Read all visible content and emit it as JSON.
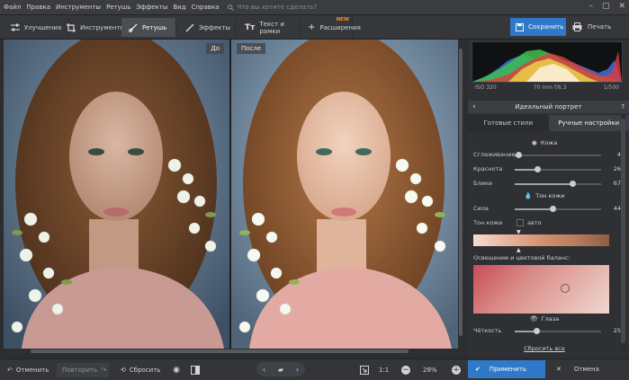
{
  "menu": {
    "items": [
      "Файл",
      "Правка",
      "Инструменты",
      "Ретушь",
      "Эффекты",
      "Вид",
      "Справка"
    ],
    "search_placeholder": "Что вы хотите сделать?"
  },
  "toolbar": {
    "tabs": [
      "Улучшения",
      "Инструменты",
      "Ретушь",
      "Эффекты",
      "Текст и рамки",
      "Расширения"
    ],
    "new_badge": "NEW",
    "save_label": "Сохранить",
    "print_label": "Печать"
  },
  "canvas": {
    "before_label": "До",
    "after_label": "После"
  },
  "histogram": {
    "exif": [
      "ISO 320",
      "70 mm f/6.3",
      "1/500"
    ]
  },
  "panel": {
    "title": "Идеальный портрет",
    "help": "?",
    "subtabs": [
      "Готовые стили",
      "Ручные настройки"
    ],
    "skin_section": "Кожа",
    "sliders_skin": [
      {
        "label": "Сглаживание",
        "value": "4",
        "fraction": 0.04
      },
      {
        "label": "Краснота",
        "value": "26",
        "fraction": 0.26
      },
      {
        "label": "Блики",
        "value": "67",
        "fraction": 0.67
      }
    ],
    "tone_section": "Тон кожи",
    "slider_strength": {
      "label": "Сила",
      "value": "44",
      "fraction": 0.44
    },
    "tone_label": "Тон кожи",
    "auto_label": "авто",
    "lighting_label": "Освещение и цветовой баланс:",
    "eyes_section": "Глаза",
    "slider_sharpness": {
      "label": "Чёткость",
      "value": "25",
      "fraction": 0.25
    },
    "reset_label": "Сбросить все"
  },
  "bottom": {
    "undo_label": "Отменить",
    "redo_label": "Повторить",
    "reset_label": "Сбросить",
    "zoom_1to1": "1:1",
    "zoom_value": "28%",
    "apply_label": "Применить",
    "cancel_label": "Отмена"
  },
  "colors": {
    "accent": "#2f79c8",
    "new_badge": "#ff8a2a"
  }
}
